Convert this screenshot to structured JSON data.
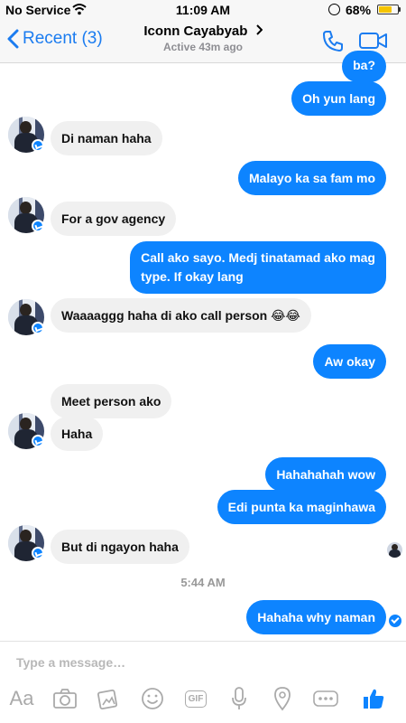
{
  "status_bar": {
    "carrier": "No Service",
    "time": "11:09 AM",
    "battery": "68%",
    "battery_level": 0.68
  },
  "nav": {
    "back_label": "Recent (3)",
    "contact_name": "Iconn Cayabyab",
    "active_status": "Active 43m ago"
  },
  "messages": [
    {
      "side": "out",
      "text": "ba?"
    },
    {
      "side": "out",
      "text": "Oh yun lang"
    },
    {
      "side": "in",
      "text": "Di naman haha"
    },
    {
      "side": "out",
      "text": "Malayo ka sa fam mo"
    },
    {
      "side": "in",
      "text": "For a gov agency"
    },
    {
      "side": "out",
      "text": "Call ako sayo. Medj tinatamad ako mag"
    },
    {
      "side": "out",
      "text": "type. If okay lang"
    },
    {
      "side": "in",
      "text": "Waaaaggg haha di ako call person 😂😂"
    },
    {
      "side": "out",
      "text": "Aw okay"
    },
    {
      "side": "in",
      "text": "Meet person ako"
    },
    {
      "side": "in",
      "text": "Haha"
    },
    {
      "side": "out",
      "text": "Hahahahah wow"
    },
    {
      "side": "out",
      "text": "Edi punta ka maginhawa"
    },
    {
      "side": "in",
      "text": "But di ngayon haha"
    },
    {
      "side": "out",
      "text": "Hahaha why naman"
    }
  ],
  "timestamp": "5:44 AM",
  "composer": {
    "placeholder": "Type a message…"
  },
  "toolbar": {
    "text_label": "Aa",
    "gif_label": "GIF",
    "icons": [
      "text-format-icon",
      "camera-icon",
      "gallery-icon",
      "emoji-icon",
      "gif-icon",
      "microphone-icon",
      "location-icon",
      "more-icon",
      "like-icon"
    ]
  },
  "colors": {
    "accent": "#0d84ff",
    "incoming_bubble": "#f0f0f0",
    "link_blue": "#1b7cf0"
  }
}
